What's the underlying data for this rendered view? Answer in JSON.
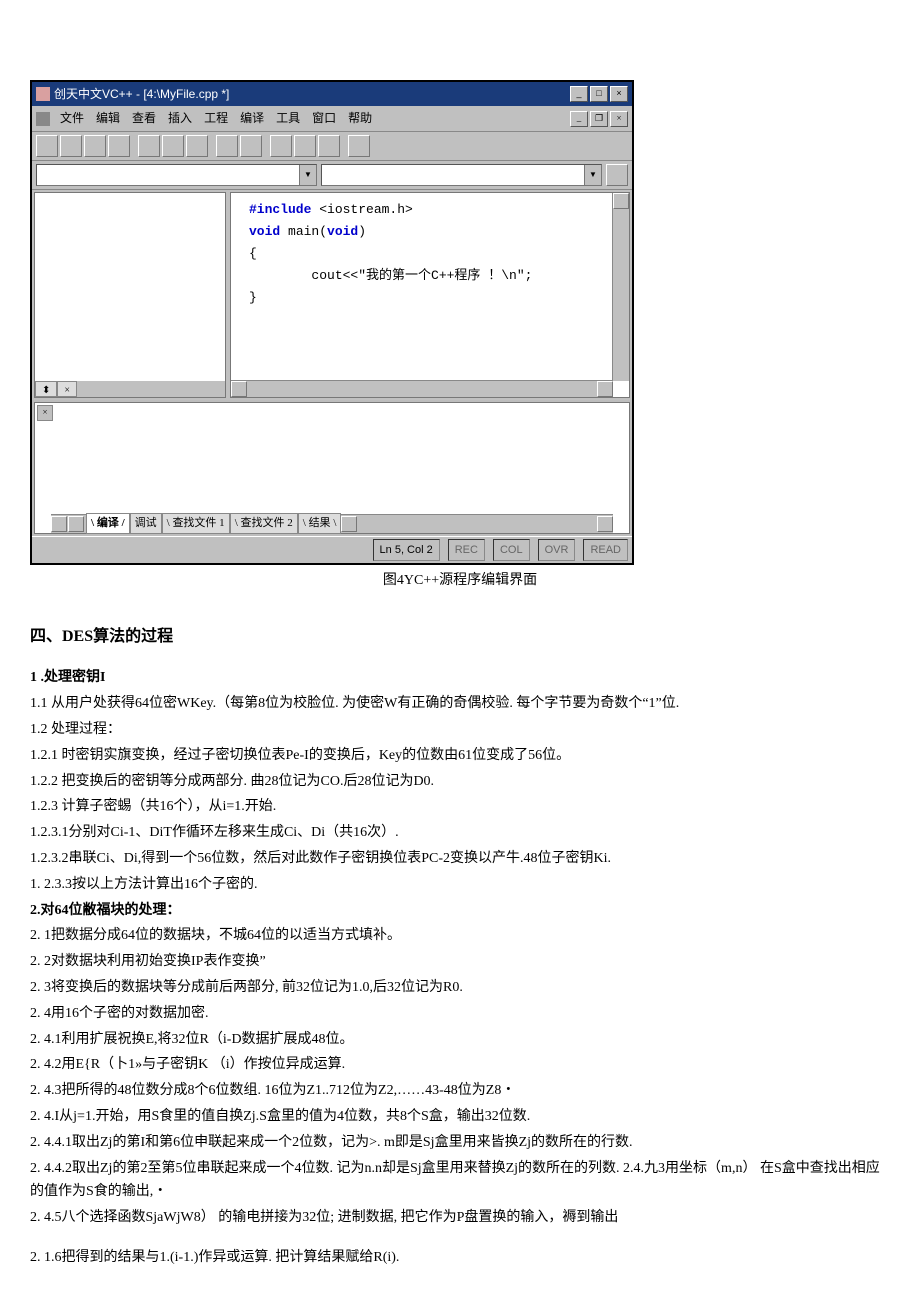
{
  "ide": {
    "title": "创天中文VC++ - [4:\\MyFile.cpp *]",
    "menu": [
      "文件",
      "编辑",
      "查看",
      "插入",
      "工程",
      "编译",
      "工具",
      "窗口",
      "帮助"
    ],
    "code_line1_kw1": "#include",
    "code_line1_rest": " <iostream.h>",
    "code_line2_kw": "void",
    "code_line2_rest": " main(",
    "code_line2_kw2": "void",
    "code_line2_rest2": ")",
    "code_line3": "{",
    "code_line4": "        cout<<\"我的第一个C++程序 ！\\n\";",
    "code_line5": "}",
    "output_tabs": {
      "nav_left": "◀▶",
      "t1": "编译",
      "t2": "调试",
      "t3": "查找文件 1",
      "t4": "查找文件 2",
      "t5": "结果",
      "nav_right": "◀"
    },
    "status": {
      "pos": "Ln 5, Col 2",
      "rec": "REC",
      "col": "COL",
      "ovr": "OVR",
      "read": "READ"
    }
  },
  "caption": "图4YC++源程序编辑界面",
  "h2": "四、DES算法的过程",
  "sec1_title": "1 .处理密钥I",
  "lines": {
    "l1": "1.1    从用户处获得64位密WKey.（每第8位为校脸位. 为使密W有正确的奇偶校验. 每个字节要为奇数个“1”位.",
    "l2": "1.2    处理过程：",
    "l3": "1.2.1    时密钥实旗变换，经过子密切换位表Pe-I的变换后，Key的位数由61位变成了56位。",
    "l4": "1.2.2    把变换后的密钥等分成两部分. 曲28位记为CO.后28位记为D0.",
    "l5": "1.2.3    计算子密蜴（共16个），从i=1.开始.",
    "l6": "1.2.3.1分别对Ci-1、DiT作循环左移来生成Ci、Di（共16次）.",
    "l7": "1.2.3.2串联Ci、Di,得到一个56位数，然后对此数作子密钥换位表PC-2变换以产牛.48位子密钥Ki.",
    "l8": "1.   2.3.3按以上方法计算出16个子密的.",
    "sec2_title": "2.对64位敝福块的处理：",
    "l9": "2.   1把数据分成64位的数据块，不城64位的以适当方式填补。",
    "l10": "2.   2对数据块利用初始变换IP表作变换”",
    "l11": "2.   3将变换后的数据块等分成前后两部分, 前32位记为1.0,后32位记为R0.",
    "l12": "2.   4用16个子密的对数据加密.",
    "l13": "2.   4.1利用扩展祝换E,将32位R（i-D数据扩展成48位。",
    "l14": "2.   4.2用E{R（卜1»与子密钥K （i）作按位异成运算.",
    "l15": "2.   4.3把所得的48位数分成8个6位数组. 16位为Z1..712位为Z2,……43-48位为Z8・",
    "l16": "2.   4.I从j=1.开始，用S食里的值自换Zj.S盒里的值为4位数，共8个S盒，输出32位数.",
    "l17": "2.   4.4.1取出Zj的第I和第6位申联起来成一个2位数，记为>. m即是Sj盒里用来皆换Zj的数所在的行数.",
    "l18": "2.   4.4.2取出Zj的第2至第5位串联起来成一个4位数. 记为n.n却是Sj盒里用来替换Zj的数所在的列数. 2.4.九3用坐标（m,n） 在S盒中查找出相应的值作为S食的输出,・",
    "l19": "2.   4.5八个选择函数SjaWjW8） 的输电拼接为32位; 进制数据, 把它作为P盘置换的输入，褥到输出",
    "l20": "2.   1.6把得到的结果与1.(i-1.)作异或运算. 把计算结果赋给R(i)."
  }
}
